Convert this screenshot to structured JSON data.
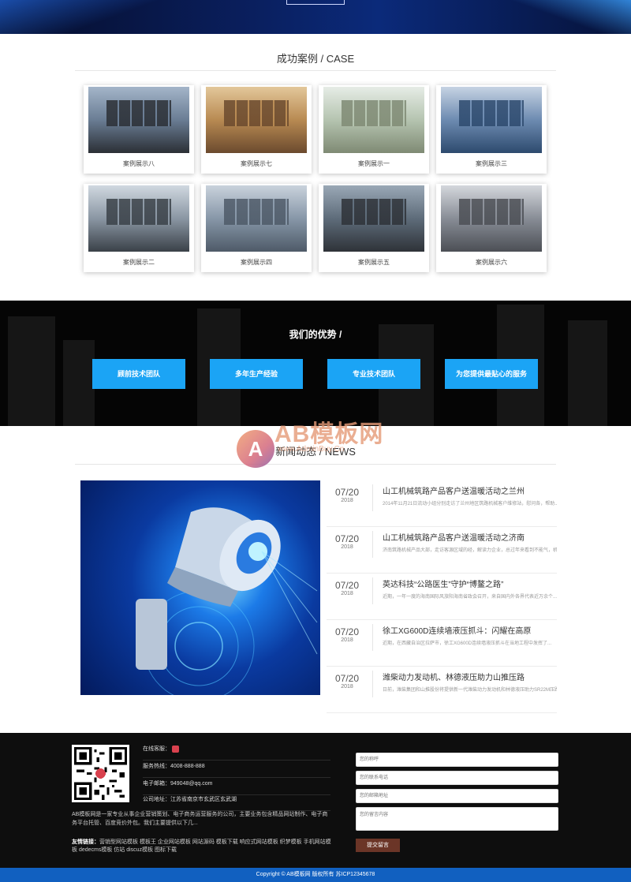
{
  "case_section": {
    "title": "成功案例 / CASE",
    "items": [
      {
        "caption": "案例展示八",
        "icon": "control-room-image"
      },
      {
        "caption": "案例展示七",
        "icon": "store-entrance-image"
      },
      {
        "caption": "案例展示一",
        "icon": "security-gate-image"
      },
      {
        "caption": "案例展示三",
        "icon": "monitoring-center-image"
      },
      {
        "caption": "案例展示二",
        "icon": "video-wall-image"
      },
      {
        "caption": "案例展示四",
        "icon": "building-facade-image"
      },
      {
        "caption": "案例展示五",
        "icon": "surveillance-screens-image"
      },
      {
        "caption": "案例展示六",
        "icon": "office-meeting-image"
      }
    ]
  },
  "advantage_section": {
    "title": "我们的优势 /",
    "buttons": [
      "顾前技术团队",
      "多年生产经验",
      "专业技术团队",
      "为您提供最贴心的服务"
    ],
    "accent_color": "#1ba4f5"
  },
  "news_section": {
    "title": "新闻动态 / NEWS",
    "image_icon": "security-camera-image",
    "items": [
      {
        "date": "07/20",
        "year": "2018",
        "title": "山工机械筑路产品客户送温暖活动之兰州",
        "desc": "2014年11月21日流动小组分别走访了兰州地区筑路机械客户维修站，慰问各，帮助..."
      },
      {
        "date": "07/20",
        "year": "2018",
        "title": "山工机械筑路产品客户送温暖活动之济南",
        "desc": "济南筑路机械产品大部，走访客源区域的经，解读力企业，总过年来看到不能气，机..."
      },
      {
        "date": "07/20",
        "year": "2018",
        "title": "英达科技“公路医生”守护“博鳌之路”",
        "desc": "近期，一年一度的海南国际风旅阳海南省政会召开，来自国内外各界代表近万余个..."
      },
      {
        "date": "07/20",
        "year": "2018",
        "title": "徐工XG600D连续墙液压抓斗：闪耀在高原",
        "desc": "近期，在西藏自治区拉萨市，徐工XG600D连续墙液压抓斗在当地工程中发挥了..."
      },
      {
        "date": "07/20",
        "year": "2018",
        "title": "潍柴动力发动机、林德液压助力山推压路",
        "desc": "日前，潍柴集团和山推股份将提供新一代潍柴动力发动机和林德液压助力SR22M压路..."
      }
    ]
  },
  "watermark": {
    "logo_letter": "A",
    "brand": "AB模板网",
    "url": "www.AdminBuy.Cn"
  },
  "footer": {
    "contact": [
      {
        "label": "在线客服：",
        "value": ""
      },
      {
        "label": "服务热线：",
        "value": "4008-888-888"
      },
      {
        "label": "电子邮箱：",
        "value": "949048@qq.com"
      },
      {
        "label": "公司地址：",
        "value": "江苏省南京市玄武区玄武湖"
      }
    ],
    "about": "AB模板网是一家专业从事企业营销策划、电子商务运营服务的公司，主要业务包含精品网站制作、电子商务平台托管、百度竞价外包。我们主要提供以下几...",
    "links_label": "友情链接：",
    "links": "营销型网站模板 模板王 企业网站模板 网站源码 模板下载 响应式网站模板 织梦模板 手机网站模板 dedecms模板 仿站 discuz模板 图标下载",
    "form": {
      "name_placeholder": "您的称呼",
      "phone_placeholder": "您的联系电话",
      "email_placeholder": "您的邮箱地址",
      "message_placeholder": "您的留言内容",
      "submit_label": "提交留言"
    }
  },
  "copyright": "Copyright © AB模板网 版权所有   苏ICP12345678"
}
